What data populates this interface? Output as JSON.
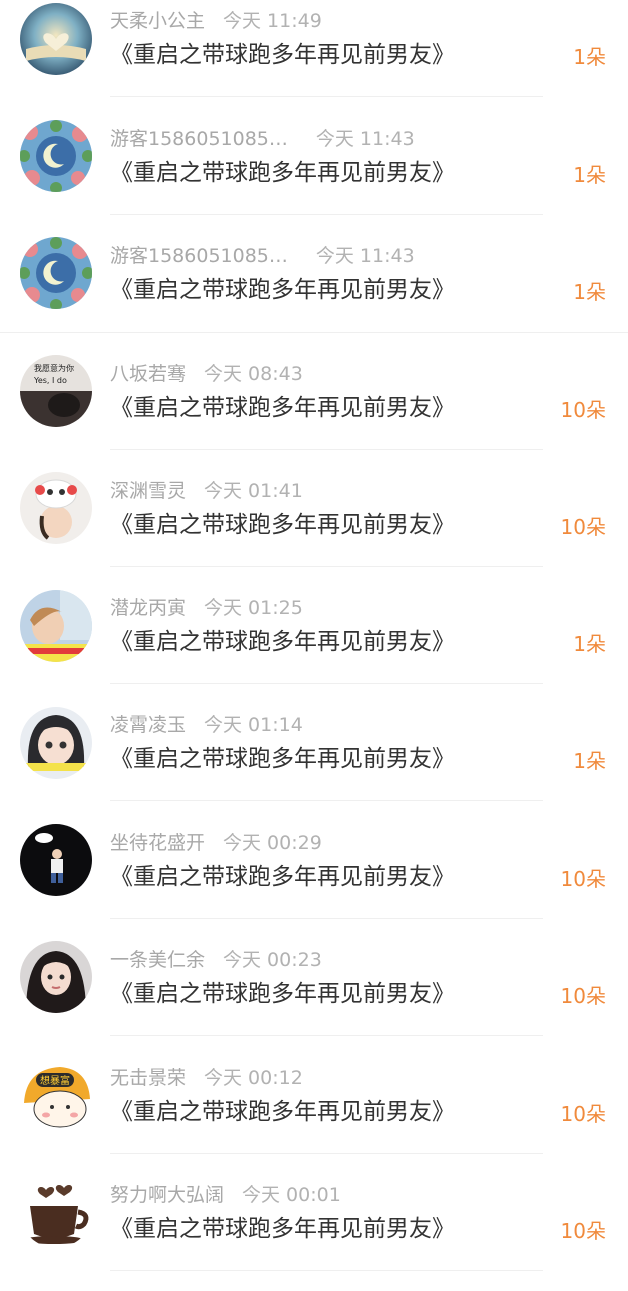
{
  "gifts": [
    {
      "name": "天柔小公主",
      "time": "今天 11:49",
      "title": "《重启之带球跑多年再见前男友》",
      "count": "1朵",
      "avatar": "book-heart-avatar"
    },
    {
      "name": "游客1586051085…",
      "time": "今天 11:43",
      "title": "《重启之带球跑多年再见前男友》",
      "count": "1朵",
      "avatar": "flower-moon-avatar"
    },
    {
      "name": "游客1586051085…",
      "time": "今天 11:43",
      "title": "《重启之带球跑多年再见前男友》",
      "count": "1朵",
      "avatar": "flower-moon-avatar"
    },
    {
      "name": "八坂若骞",
      "time": "今天 08:43",
      "title": "《重启之带球跑多年再见前男友》",
      "count": "10朵",
      "avatar": "text-cat-avatar",
      "avatar_text": [
        "我愿意为你",
        "Yes, I do"
      ]
    },
    {
      "name": "深渊雪灵",
      "time": "今天 01:41",
      "title": "《重启之带球跑多年再见前男友》",
      "count": "10朵",
      "avatar": "girl-hat-avatar"
    },
    {
      "name": "潜龙丙寅",
      "time": "今天 01:25",
      "title": "《重启之带球跑多年再见前男友》",
      "count": "1朵",
      "avatar": "boy-photo-avatar"
    },
    {
      "name": "凌霄凌玉",
      "time": "今天 01:14",
      "title": "《重启之带球跑多年再见前男友》",
      "count": "1朵",
      "avatar": "anime-girl-avatar"
    },
    {
      "name": "坐待花盛开",
      "time": "今天 00:29",
      "title": "《重启之带球跑多年再见前男友》",
      "count": "10朵",
      "avatar": "night-boy-avatar"
    },
    {
      "name": "一条美仁余",
      "time": "今天 00:23",
      "title": "《重启之带球跑多年再见前男友》",
      "count": "10朵",
      "avatar": "longhair-girl-avatar"
    },
    {
      "name": "无击景荣",
      "time": "今天 00:12",
      "title": "《重启之带球跑多年再见前男友》",
      "count": "10朵",
      "avatar": "cartoon-helmet-avatar",
      "avatar_text": [
        "想暴富"
      ]
    },
    {
      "name": "努力啊大弘阔",
      "time": "今天 00:01",
      "title": "《重启之带球跑多年再见前男友》",
      "count": "10朵",
      "avatar": "coffee-cup-avatar"
    }
  ],
  "colors": {
    "count": "#f08a3c",
    "title": "#333333",
    "meta": "#a8a8a8",
    "divider": "#efefef"
  }
}
